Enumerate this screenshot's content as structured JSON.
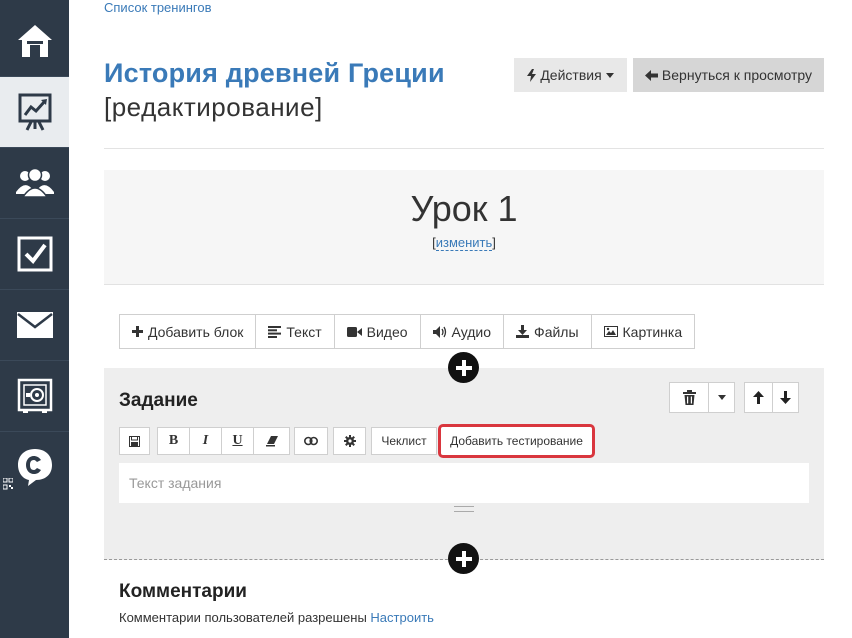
{
  "breadcrumb": "Список тренингов",
  "title": {
    "name": "История древней Греции",
    "mode": "[редактирование]"
  },
  "header_buttons": {
    "actions": "Действия",
    "back": "Вернуться к просмотру"
  },
  "lesson": {
    "title": "Урок 1",
    "edit_open": "[",
    "edit_link": "изменить",
    "edit_close": "]"
  },
  "toolbar": {
    "add_block": "Добавить блок",
    "text": "Текст",
    "video": "Видео",
    "audio": "Аудио",
    "files": "Файлы",
    "picture": "Картинка"
  },
  "task": {
    "title": "Задание",
    "checklist": "Чеклист",
    "add_test": "Добавить тестирование",
    "placeholder": "Текст задания",
    "bold": "B",
    "italic": "I",
    "underline": "U"
  },
  "comments": {
    "title": "Комментарии",
    "text": "Комментарии пользователей разрешены ",
    "link": "Настроить"
  },
  "colors": {
    "sidebar": "#2e3a48",
    "accent": "#3a7ab8",
    "highlight": "#d9363e"
  }
}
